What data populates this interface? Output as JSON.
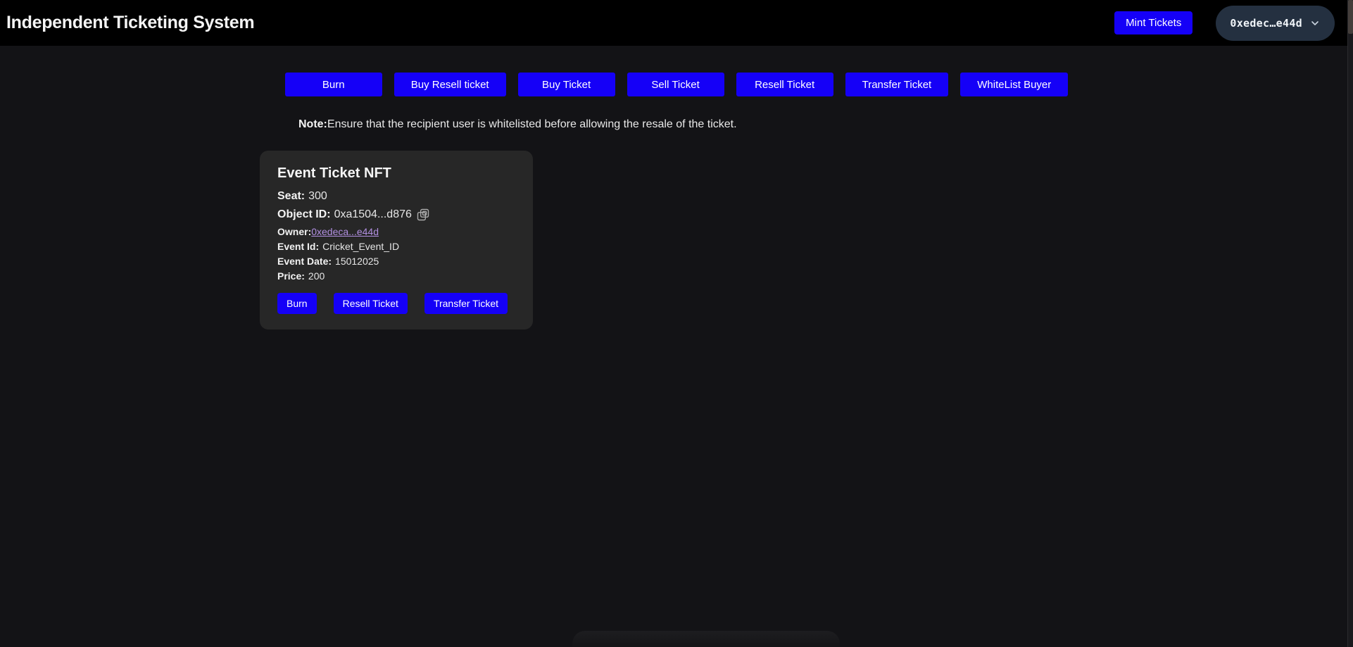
{
  "header": {
    "title": "Independent Ticketing System",
    "mint_button": "Mint Tickets",
    "wallet_address": "0xedec…e44d"
  },
  "actions": {
    "buttons": [
      "Burn",
      "Buy Resell ticket",
      "Buy Ticket",
      "Sell Ticket",
      "Resell Ticket",
      "Transfer Ticket",
      "WhiteList Buyer"
    ]
  },
  "note": {
    "label": "Note:",
    "text": "Ensure that the recipient user is whitelisted before allowing the resale of the ticket."
  },
  "ticket_card": {
    "title": "Event Ticket NFT",
    "seat_label": "Seat:",
    "seat_value": "300",
    "object_id_label": "Object ID:",
    "object_id_value": "0xa1504...d876",
    "copy_icon": "copy-icon",
    "owner_label": "Owner:",
    "owner_link": "0xedeca...e44d",
    "event_id_label": "Event Id:",
    "event_id_value": "Cricket_Event_ID",
    "event_date_label": "Event Date:",
    "event_date_value": "15012025",
    "price_label": "Price:",
    "price_value": "200",
    "buttons": [
      "Burn",
      "Resell Ticket",
      "Transfer Ticket"
    ]
  },
  "colors": {
    "header_bg": "#000000",
    "page_bg": "#131316",
    "card_bg": "#272727",
    "accent_blue": "#1500f7",
    "wallet_pill_bg": "#243040",
    "owner_link": "#b18fe0"
  }
}
